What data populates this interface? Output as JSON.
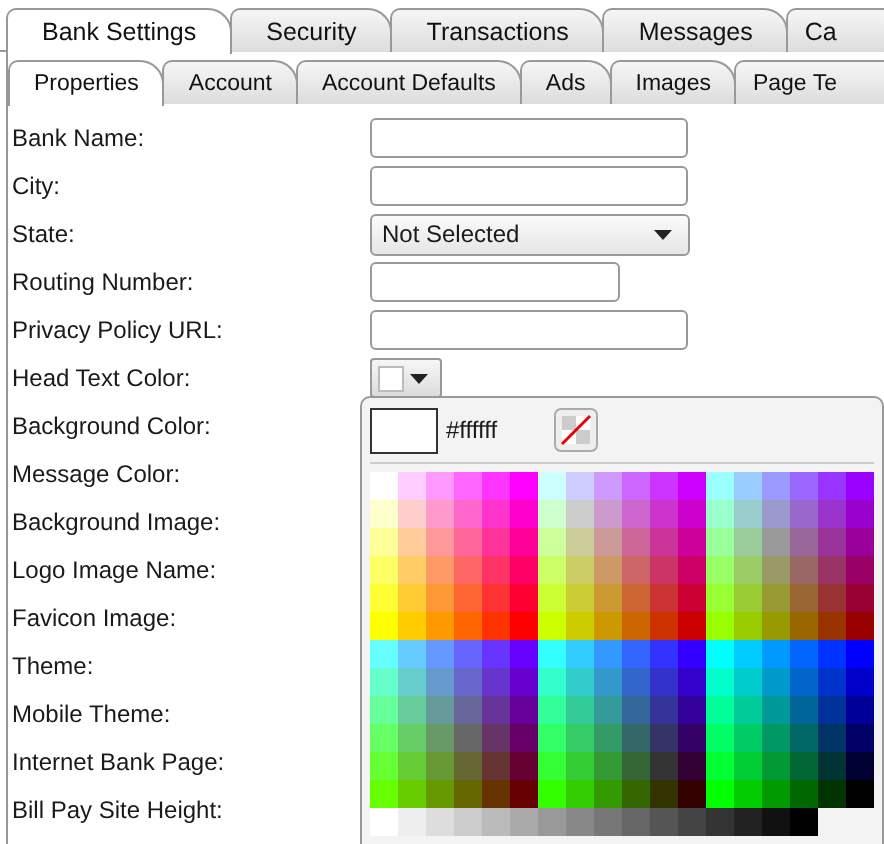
{
  "main_tabs": [
    {
      "label": "Bank Settings",
      "selected": true
    },
    {
      "label": "Security",
      "selected": false
    },
    {
      "label": "Transactions",
      "selected": false
    },
    {
      "label": "Messages",
      "selected": false
    },
    {
      "label": "Ca",
      "selected": false
    }
  ],
  "sub_tabs": [
    {
      "label": "Properties",
      "selected": true
    },
    {
      "label": "Account",
      "selected": false
    },
    {
      "label": "Account Defaults",
      "selected": false
    },
    {
      "label": "Ads",
      "selected": false
    },
    {
      "label": "Images",
      "selected": false
    },
    {
      "label": "Page Te",
      "selected": false
    }
  ],
  "fields": [
    {
      "label": "Bank Name:",
      "kind": "text"
    },
    {
      "label": "City:",
      "kind": "text"
    },
    {
      "label": "State:",
      "kind": "select",
      "value": "Not Selected"
    },
    {
      "label": "Routing Number:",
      "kind": "short"
    },
    {
      "label": "Privacy Policy URL:",
      "kind": "text"
    },
    {
      "label": "Head Text Color:",
      "kind": "color"
    },
    {
      "label": "Background Color:",
      "kind": "hidden"
    },
    {
      "label": "Message Color:",
      "kind": "hidden"
    },
    {
      "label": "Background Image:",
      "kind": "hidden"
    },
    {
      "label": "Logo Image Name:",
      "kind": "hidden"
    },
    {
      "label": "Favicon Image:",
      "kind": "hidden"
    },
    {
      "label": "Theme:",
      "kind": "hidden"
    },
    {
      "label": "Mobile Theme:",
      "kind": "hidden"
    },
    {
      "label": "Internet Bank Page:",
      "kind": "hidden"
    },
    {
      "label": "Bill Pay Site Height:",
      "kind": "hidden"
    }
  ],
  "color_picker": {
    "value": "#ffffff"
  }
}
